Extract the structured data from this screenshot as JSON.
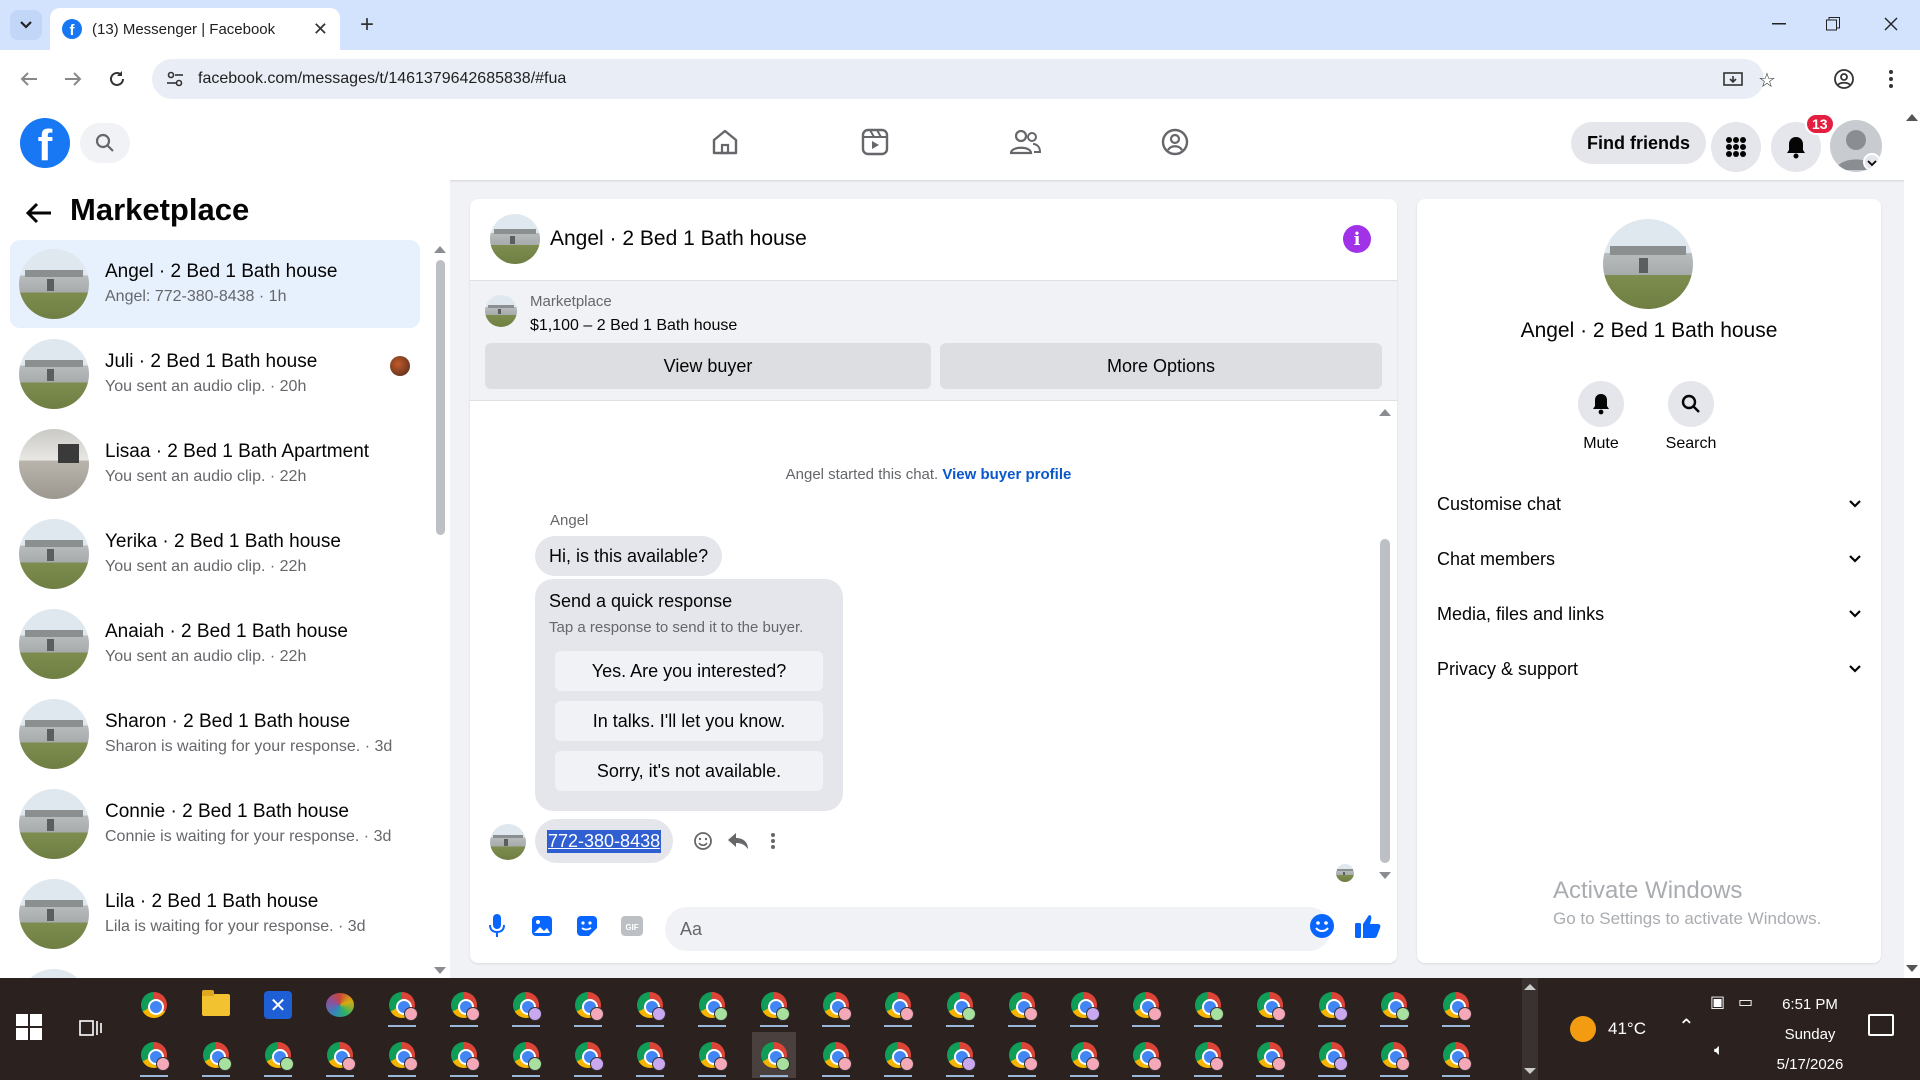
{
  "browser": {
    "tab_title": "(13) Messenger | Facebook",
    "url": "facebook.com/messages/t/1461379642685838/#fua",
    "new_tab": "+",
    "close_tab": "✕"
  },
  "header": {
    "find_friends": "Find friends",
    "notification_count": "13"
  },
  "sidebar": {
    "title": "Marketplace",
    "conversations": [
      {
        "name": "Angel · 2 Bed 1 Bath house",
        "preview": "Angel: 772-380-8438 · 1h",
        "active": true
      },
      {
        "name": "Juli · 2 Bed 1 Bath house",
        "preview": "You sent an audio clip. · 20h"
      },
      {
        "name": "Lisaa · 2 Bed 1 Bath Apartment",
        "preview": "You sent an audio clip. · 22h"
      },
      {
        "name": "Yerika · 2 Bed 1 Bath house",
        "preview": "You sent an audio clip. · 22h"
      },
      {
        "name": "Anaiah · 2 Bed 1 Bath house",
        "preview": "You sent an audio clip. · 22h"
      },
      {
        "name": "Sharon · 2 Bed 1 Bath house",
        "preview": "Sharon is waiting for your response. · 3d"
      },
      {
        "name": "Connie · 2 Bed 1 Bath house",
        "preview": "Connie is waiting for your response. · 3d"
      },
      {
        "name": "Lila · 2 Bed 1 Bath house",
        "preview": "Lila is waiting for your response. · 3d"
      }
    ]
  },
  "chat": {
    "title": "Angel · 2 Bed 1 Bath house",
    "listing": {
      "source": "Marketplace",
      "price_title": "$1,100 – 2 Bed 1 Bath house",
      "view_buyer": "View buyer",
      "more_options": "More Options"
    },
    "started_text": "Angel started this chat.",
    "buyer_profile_link": "View buyer profile",
    "sender": "Angel",
    "message1": "Hi, is this available?",
    "quick_response": {
      "title": "Send a quick response",
      "subtitle": "Tap a response to send it to the buyer.",
      "options": [
        "Yes. Are you interested?",
        "In talks. I'll let you know.",
        "Sorry, it's not available."
      ]
    },
    "phone_message": "772-380-8438",
    "input_placeholder": "Aa"
  },
  "info_panel": {
    "name": "Angel · 2 Bed 1 Bath house",
    "mute": "Mute",
    "search": "Search",
    "sections": [
      "Customise chat",
      "Chat members",
      "Media, files and links",
      "Privacy & support"
    ],
    "activate_title": "Activate Windows",
    "activate_sub": "Go to Settings to activate Windows."
  },
  "taskbar": {
    "temperature": "41°C",
    "time": "6:51 PM",
    "day": "Sunday",
    "date": "5/17/2026"
  },
  "colors": {
    "facebook_blue": "#1877f2",
    "messenger_purple": "#a033e8",
    "badge_red": "#e41e3f",
    "selection_blue": "#2f5fd1"
  }
}
